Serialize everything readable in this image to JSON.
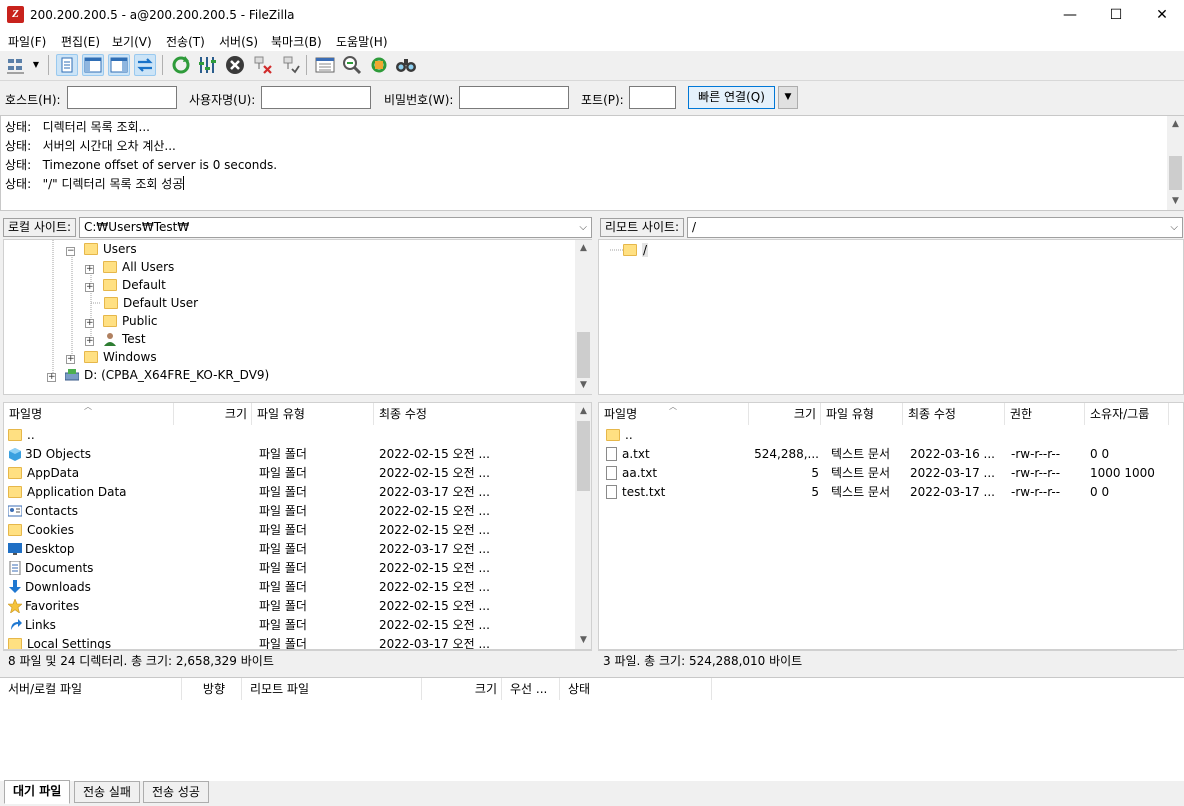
{
  "window": {
    "title": "200.200.200.5 - a@200.200.200.5 - FileZilla",
    "app_icon_letter": "Z",
    "minimize": "—",
    "maximize": "☐",
    "close": "✕"
  },
  "menu": [
    "파일(F)",
    "편집(E)",
    "보기(V)",
    "전송(T)",
    "서버(S)",
    "북마크(B)",
    "도움말(H)"
  ],
  "quickconnect": {
    "host_label": "호스트(H):",
    "user_label": "사용자명(U):",
    "pass_label": "비밀번호(W):",
    "port_label": "포트(P):",
    "host_value": "",
    "user_value": "",
    "pass_value": "",
    "port_value": "",
    "connect_label": "빠른 연결(Q)",
    "dropdown_glyph": "▼"
  },
  "log": [
    {
      "prefix": "상태:",
      "text": "디렉터리 목록 조회..."
    },
    {
      "prefix": "상태:",
      "text": "서버의 시간대 오차 계산..."
    },
    {
      "prefix": "상태:",
      "text": "Timezone offset of server is 0 seconds."
    },
    {
      "prefix": "상태:",
      "text": "\"/\" 디렉터리 목록 조회 성공"
    }
  ],
  "local": {
    "site_label": "로컬 사이트:",
    "path": "C:₩Users₩Test₩",
    "tree": [
      {
        "label": "Users",
        "expander": "−"
      },
      {
        "label": "All Users",
        "expander": "+"
      },
      {
        "label": "Default",
        "expander": "+"
      },
      {
        "label": "Default User",
        "expander": ""
      },
      {
        "label": "Public",
        "expander": "+"
      },
      {
        "label": "Test",
        "expander": "+"
      },
      {
        "label": "Windows",
        "expander": "+"
      },
      {
        "label": "D: (CPBA_X64FRE_KO-KR_DV9)",
        "expander": "+"
      }
    ],
    "headers": {
      "name": "파일명",
      "size": "크기",
      "type": "파일 유형",
      "modified": "최종 수정"
    },
    "files": [
      {
        "name": "..",
        "type": "",
        "modified": "",
        "icon": "folder"
      },
      {
        "name": "3D Objects",
        "type": "파일 폴더",
        "modified": "2022-02-15 오전 ...",
        "icon": "cube"
      },
      {
        "name": "AppData",
        "type": "파일 폴더",
        "modified": "2022-02-15 오전 ...",
        "icon": "folder"
      },
      {
        "name": "Application Data",
        "type": "파일 폴더",
        "modified": "2022-03-17 오전 ...",
        "icon": "folder"
      },
      {
        "name": "Contacts",
        "type": "파일 폴더",
        "modified": "2022-02-15 오전 ...",
        "icon": "contacts"
      },
      {
        "name": "Cookies",
        "type": "파일 폴더",
        "modified": "2022-02-15 오전 ...",
        "icon": "folder"
      },
      {
        "name": "Desktop",
        "type": "파일 폴더",
        "modified": "2022-03-17 오전 ...",
        "icon": "desktop"
      },
      {
        "name": "Documents",
        "type": "파일 폴더",
        "modified": "2022-02-15 오전 ...",
        "icon": "document"
      },
      {
        "name": "Downloads",
        "type": "파일 폴더",
        "modified": "2022-02-15 오전 ...",
        "icon": "download"
      },
      {
        "name": "Favorites",
        "type": "파일 폴더",
        "modified": "2022-02-15 오전 ...",
        "icon": "star"
      },
      {
        "name": "Links",
        "type": "파일 폴더",
        "modified": "2022-02-15 오전 ...",
        "icon": "link"
      },
      {
        "name": "Local Settings",
        "type": "파일 폴더",
        "modified": "2022-03-17 오전 ...",
        "icon": "folder"
      }
    ],
    "status": "8 파일 및 24 디렉터리. 총 크기: 2,658,329 바이트"
  },
  "remote": {
    "site_label": "리모트 사이트:",
    "path": "/",
    "tree": [
      {
        "label": "/"
      }
    ],
    "headers": {
      "name": "파일명",
      "size": "크기",
      "type": "파일 유형",
      "modified": "최종 수정",
      "perms": "권한",
      "owner": "소유자/그룹"
    },
    "files": [
      {
        "name": "..",
        "size": "",
        "type": "",
        "modified": "",
        "perms": "",
        "owner": "",
        "icon": "folder"
      },
      {
        "name": "a.txt",
        "size": "524,288,...",
        "type": "텍스트 문서",
        "modified": "2022-03-16 ...",
        "perms": "-rw-r--r--",
        "owner": "0 0",
        "icon": "file"
      },
      {
        "name": "aa.txt",
        "size": "5",
        "type": "텍스트 문서",
        "modified": "2022-03-17 ...",
        "perms": "-rw-r--r--",
        "owner": "1000 1000",
        "icon": "file"
      },
      {
        "name": "test.txt",
        "size": "5",
        "type": "텍스트 문서",
        "modified": "2022-03-17 ...",
        "perms": "-rw-r--r--",
        "owner": "0 0",
        "icon": "file"
      }
    ],
    "status": "3 파일. 총 크기: 524,288,010 바이트"
  },
  "queue": {
    "headers": [
      "서버/로컬 파일",
      "방향",
      "리모트 파일",
      "크기",
      "우선 ...",
      "상태"
    ]
  },
  "tabs": [
    "대기 파일",
    "전송 실패",
    "전송 성공"
  ],
  "colors": {
    "accent": "#0078d7",
    "folder": "#ffe082",
    "refresh": "#2e9b3a",
    "cancel": "#3a3a3a"
  }
}
